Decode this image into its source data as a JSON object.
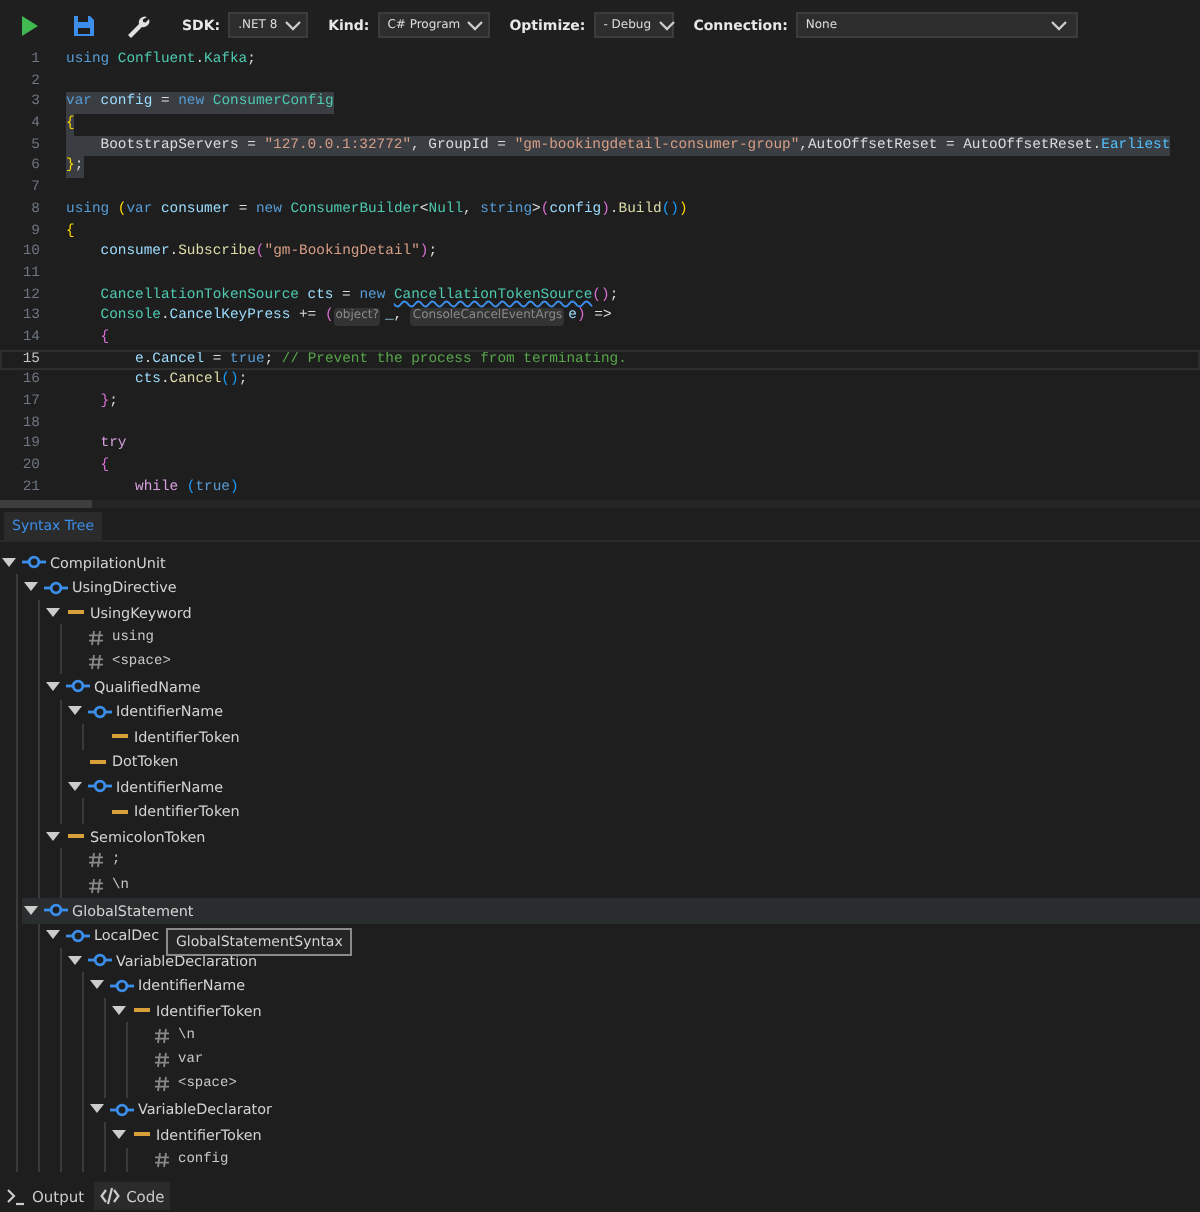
{
  "toolbar": {
    "buttons": [
      {
        "kind": "run"
      },
      {
        "kind": "save"
      },
      {
        "kind": "tools"
      }
    ],
    "fields": [
      {
        "label": "SDK:",
        "value": ".NET 8"
      },
      {
        "label": "Kind:",
        "value": "C# Program"
      },
      {
        "label": "Optimize:",
        "value": "- Debug"
      },
      {
        "label": "Connection:",
        "value": "None"
      }
    ]
  },
  "editor": {
    "lines": [
      {
        "number": "1",
        "selected": false,
        "current": false,
        "tokens": [
          {
            "kind": "kw",
            "text": "using "
          },
          {
            "kind": "type",
            "text": "Confluent"
          },
          {
            "kind": "plain",
            "text": "."
          },
          {
            "kind": "type",
            "text": "Kafka"
          },
          {
            "kind": "plain",
            "text": ";"
          }
        ]
      },
      {
        "number": "2",
        "selected": false,
        "current": false
      },
      {
        "number": "3",
        "selected": true,
        "current": false,
        "tokens": [
          {
            "kind": "kw",
            "text": "var "
          },
          {
            "kind": "var",
            "text": "config"
          },
          {
            "kind": "plain",
            "text": " = "
          },
          {
            "kind": "kw",
            "text": "new "
          },
          {
            "kind": "type",
            "text": "ConsumerConfig"
          }
        ]
      },
      {
        "number": "4",
        "selected": true,
        "current": false,
        "tokens": [
          {
            "kind": "b1",
            "text": "{"
          }
        ]
      },
      {
        "number": "5",
        "selected": true,
        "current": false,
        "tokens": [
          {
            "kind": "plain",
            "text": "    BootstrapServers = "
          },
          {
            "kind": "str",
            "text": "\"127.0.0.1:32772\""
          },
          {
            "kind": "plain",
            "text": ", GroupId = "
          },
          {
            "kind": "str",
            "text": "\"gm-bookingdetail-consumer-group\""
          },
          {
            "kind": "plain",
            "text": ",AutoOffsetReset = AutoOffsetReset."
          },
          {
            "kind": "enum",
            "text": "Earliest"
          }
        ]
      },
      {
        "number": "6",
        "selected": true,
        "current": false,
        "tokens": [
          {
            "kind": "b1",
            "text": "}"
          },
          {
            "kind": "plain",
            "text": ";"
          }
        ]
      },
      {
        "number": "7",
        "selected": false,
        "current": false
      },
      {
        "number": "8",
        "selected": false,
        "current": false,
        "tokens": [
          {
            "kind": "kw",
            "text": "using "
          },
          {
            "kind": "b1",
            "text": "("
          },
          {
            "kind": "kw",
            "text": "var "
          },
          {
            "kind": "var",
            "text": "consumer"
          },
          {
            "kind": "plain",
            "text": " = "
          },
          {
            "kind": "kw",
            "text": "new "
          },
          {
            "kind": "type",
            "text": "ConsumerBuilder"
          },
          {
            "kind": "plain",
            "text": "<"
          },
          {
            "kind": "type",
            "text": "Null"
          },
          {
            "kind": "plain",
            "text": ", "
          },
          {
            "kind": "kw",
            "text": "string"
          },
          {
            "kind": "plain",
            "text": ">"
          },
          {
            "kind": "b2",
            "text": "("
          },
          {
            "kind": "var",
            "text": "config"
          },
          {
            "kind": "b2",
            "text": ")"
          },
          {
            "kind": "plain",
            "text": "."
          },
          {
            "kind": "method",
            "text": "Build"
          },
          {
            "kind": "b3",
            "text": "()"
          },
          {
            "kind": "b1",
            "text": ")"
          }
        ]
      },
      {
        "number": "9",
        "selected": false,
        "current": false,
        "tokens": [
          {
            "kind": "b1",
            "text": "{"
          }
        ]
      },
      {
        "number": "10",
        "selected": false,
        "current": false,
        "tokens": [
          {
            "kind": "var",
            "text": "    consumer"
          },
          {
            "kind": "plain",
            "text": "."
          },
          {
            "kind": "method",
            "text": "Subscribe"
          },
          {
            "kind": "b2",
            "text": "("
          },
          {
            "kind": "str",
            "text": "\"gm-BookingDetail\""
          },
          {
            "kind": "b2",
            "text": ")"
          },
          {
            "kind": "plain",
            "text": ";"
          }
        ]
      },
      {
        "number": "11",
        "selected": false,
        "current": false
      },
      {
        "number": "12",
        "selected": false,
        "current": false,
        "tokens": [
          {
            "kind": "type",
            "text": "    CancellationTokenSource "
          },
          {
            "kind": "var",
            "text": "cts"
          },
          {
            "kind": "plain",
            "text": " = "
          },
          {
            "kind": "kw",
            "text": "new "
          },
          {
            "kind": "type",
            "text": "CancellationTokenSource",
            "error": true
          },
          {
            "kind": "b2",
            "text": "()"
          },
          {
            "kind": "plain",
            "text": ";"
          }
        ]
      },
      {
        "number": "13",
        "selected": false,
        "current": false,
        "tokens": [
          {
            "kind": "type",
            "text": "    Console"
          },
          {
            "kind": "plain",
            "text": "."
          },
          {
            "kind": "var",
            "text": "CancelKeyPress"
          },
          {
            "kind": "plain",
            "text": " += "
          },
          {
            "kind": "b2",
            "text": "("
          },
          {
            "kind": "hint",
            "text": "object?"
          },
          {
            "kind": "var",
            "text": "_"
          },
          {
            "kind": "plain",
            "text": ", "
          },
          {
            "kind": "hint",
            "text": "ConsoleCancelEventArgs"
          },
          {
            "kind": "var",
            "text": "e"
          },
          {
            "kind": "b2",
            "text": ")"
          },
          {
            "kind": "plain",
            "text": " =>"
          }
        ]
      },
      {
        "number": "14",
        "selected": false,
        "current": false,
        "tokens": [
          {
            "kind": "b2",
            "text": "    {"
          }
        ]
      },
      {
        "number": "15",
        "selected": false,
        "current": true,
        "tokens": [
          {
            "kind": "var",
            "text": "        e"
          },
          {
            "kind": "plain",
            "text": "."
          },
          {
            "kind": "var",
            "text": "Cancel"
          },
          {
            "kind": "plain",
            "text": " = "
          },
          {
            "kind": "kw",
            "text": "true"
          },
          {
            "kind": "plain",
            "text": "; "
          },
          {
            "kind": "comment",
            "text": "// Prevent the process from terminating."
          }
        ]
      },
      {
        "number": "16",
        "selected": false,
        "current": false,
        "tokens": [
          {
            "kind": "var",
            "text": "        cts"
          },
          {
            "kind": "plain",
            "text": "."
          },
          {
            "kind": "method",
            "text": "Cancel"
          },
          {
            "kind": "b3",
            "text": "()"
          },
          {
            "kind": "plain",
            "text": ";"
          }
        ]
      },
      {
        "number": "17",
        "selected": false,
        "current": false,
        "tokens": [
          {
            "kind": "b2",
            "text": "    }"
          },
          {
            "kind": "plain",
            "text": ";"
          }
        ]
      },
      {
        "number": "18",
        "selected": false,
        "current": false
      },
      {
        "number": "19",
        "selected": false,
        "current": false,
        "tokens": [
          {
            "kind": "ctrl",
            "text": "    try"
          }
        ]
      },
      {
        "number": "20",
        "selected": false,
        "current": false,
        "tokens": [
          {
            "kind": "b2",
            "text": "    {"
          }
        ]
      },
      {
        "number": "21",
        "selected": false,
        "current": false,
        "tokens": [
          {
            "kind": "ctrl",
            "text": "        while "
          },
          {
            "kind": "b3",
            "text": "("
          },
          {
            "kind": "kw",
            "text": "true"
          },
          {
            "kind": "b3",
            "text": ")"
          }
        ]
      }
    ]
  },
  "panel_tab": {
    "label": "Syntax Tree",
    "selected": true
  },
  "tree": {
    "nodes": [
      {
        "label": "CompilationUnit",
        "kind": "node",
        "expanded": true,
        "selected": false,
        "children": [
          {
            "label": "UsingDirective",
            "kind": "node",
            "expanded": true,
            "selected": false,
            "children": [
              {
                "label": "UsingKeyword",
                "kind": "token",
                "expanded": true,
                "selected": false,
                "children": [
                  {
                    "label": "using",
                    "kind": "trivia",
                    "selected": false
                  },
                  {
                    "label": "<space>",
                    "kind": "trivia",
                    "selected": false
                  }
                ]
              },
              {
                "label": "QualifiedName",
                "kind": "node",
                "expanded": true,
                "selected": false,
                "children": [
                  {
                    "label": "IdentifierName",
                    "kind": "node",
                    "expanded": true,
                    "selected": false,
                    "children": [
                      {
                        "label": "IdentifierToken",
                        "kind": "token",
                        "selected": false
                      }
                    ]
                  },
                  {
                    "label": "DotToken",
                    "kind": "token",
                    "selected": false
                  },
                  {
                    "label": "IdentifierName",
                    "kind": "node",
                    "expanded": true,
                    "selected": false,
                    "children": [
                      {
                        "label": "IdentifierToken",
                        "kind": "token",
                        "selected": false
                      }
                    ]
                  }
                ]
              },
              {
                "label": "SemicolonToken",
                "kind": "token",
                "expanded": true,
                "selected": false,
                "children": [
                  {
                    "label": ";",
                    "kind": "trivia",
                    "selected": false
                  },
                  {
                    "label": "\\n",
                    "kind": "trivia",
                    "selected": false
                  }
                ]
              }
            ]
          },
          {
            "label": "GlobalStatement",
            "kind": "node",
            "expanded": true,
            "selected": true,
            "children": [
              {
                "label": "LocalDec",
                "kind": "node",
                "expanded": true,
                "selected": false,
                "children": [
                  {
                    "label": "VariableDeclaration",
                    "kind": "node",
                    "expanded": true,
                    "selected": false,
                    "children": [
                      {
                        "label": "IdentifierName",
                        "kind": "node",
                        "expanded": true,
                        "selected": false,
                        "children": [
                          {
                            "label": "IdentifierToken",
                            "kind": "token",
                            "expanded": true,
                            "selected": false,
                            "children": [
                              {
                                "label": "\\n",
                                "kind": "trivia",
                                "selected": false
                              },
                              {
                                "label": "var",
                                "kind": "trivia",
                                "selected": false
                              },
                              {
                                "label": "<space>",
                                "kind": "trivia",
                                "selected": false
                              }
                            ]
                          }
                        ]
                      },
                      {
                        "label": "VariableDeclarator",
                        "kind": "node",
                        "expanded": true,
                        "selected": false,
                        "children": [
                          {
                            "label": "IdentifierToken",
                            "kind": "token",
                            "expanded": true,
                            "selected": false,
                            "children": [
                              {
                                "label": "config",
                                "kind": "trivia",
                                "selected": false
                              }
                            ]
                          }
                        ]
                      }
                    ]
                  }
                ]
              }
            ]
          }
        ]
      }
    ],
    "tooltip": "GlobalStatementSyntax"
  },
  "bottom_tabs": [
    {
      "label": "Output",
      "kind": "output",
      "selected": false
    },
    {
      "label": "Code",
      "kind": "code",
      "selected": true
    }
  ]
}
